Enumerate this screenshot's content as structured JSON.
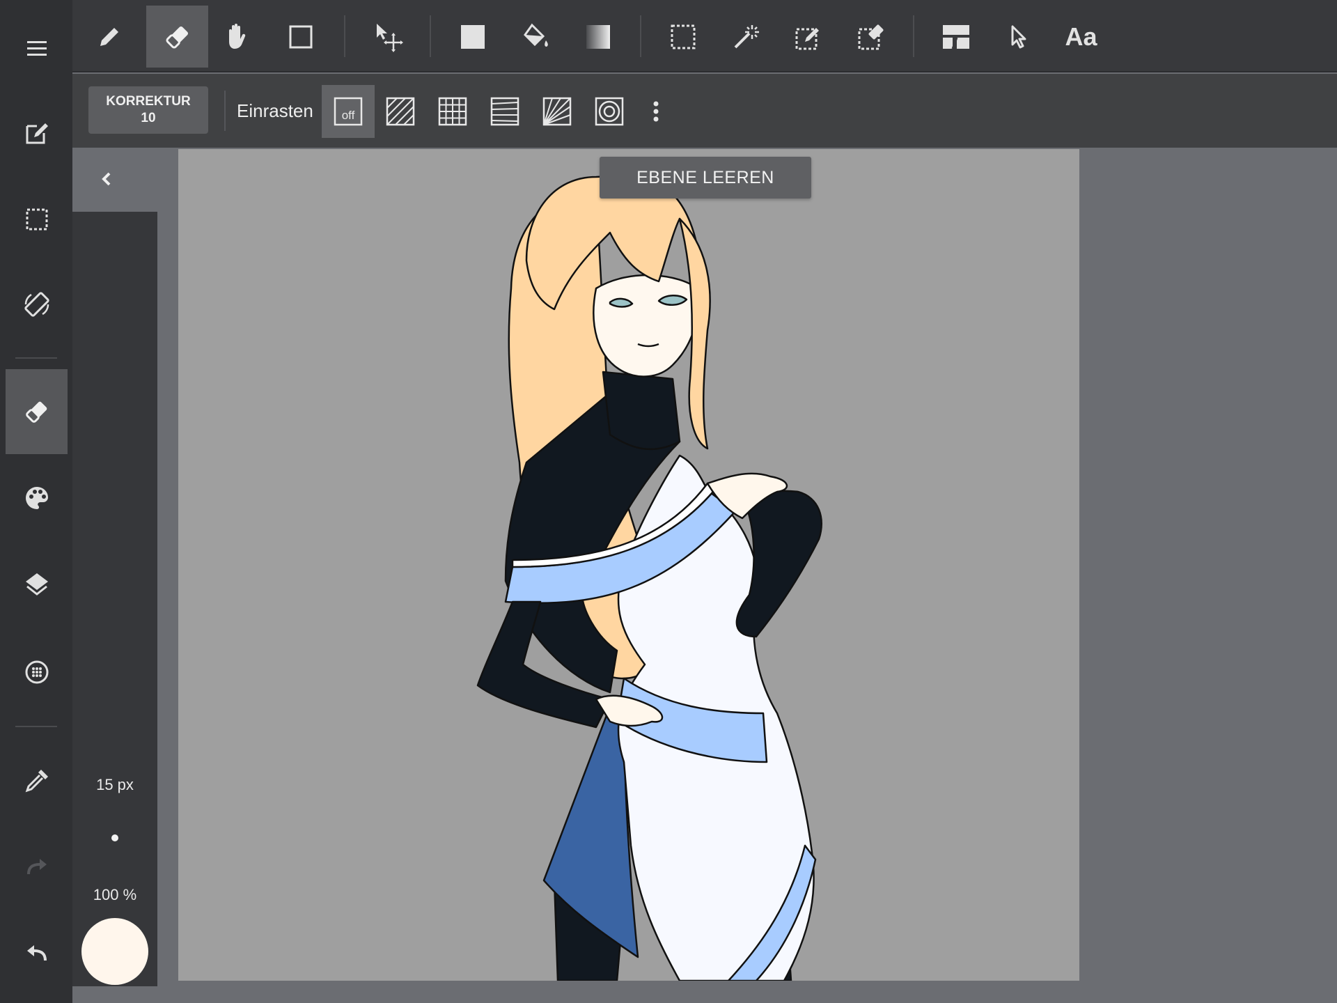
{
  "left_sidebar": {
    "items": [
      {
        "name": "menu-icon"
      },
      {
        "name": "edit-canvas-icon"
      },
      {
        "name": "selection-icon"
      },
      {
        "name": "rotate-screen-icon"
      },
      {
        "name": "eraser-icon",
        "active": true
      },
      {
        "name": "palette-icon"
      },
      {
        "name": "layers-icon"
      },
      {
        "name": "materials-icon"
      },
      {
        "name": "eyedropper-icon"
      },
      {
        "name": "redo-icon",
        "enabled": false
      },
      {
        "name": "undo-icon"
      }
    ]
  },
  "toolbar": {
    "tools": [
      "pen-icon",
      "eraser-icon",
      "hand-icon",
      "rectangle-icon",
      "move-icon",
      "fill-rect-icon",
      "bucket-icon",
      "gradient-icon",
      "select-rect-icon",
      "magic-wand-icon",
      "select-pen-icon",
      "select-eraser-icon",
      "frame-divider-icon",
      "cursor-icon"
    ],
    "active_tool": "eraser-icon",
    "text_tool_label": "Aa"
  },
  "sub_toolbar": {
    "correction_label": "KORREKTUR",
    "correction_value": "10",
    "snap_label": "Einrasten",
    "snap_off_label": "off",
    "snap_modes": [
      "snap-off",
      "snap-parallel",
      "snap-grid",
      "snap-perspective-lines",
      "snap-radial",
      "snap-circle"
    ],
    "more_icon": "more-vert-icon"
  },
  "brush": {
    "size": "15 px",
    "opacity": "100 %",
    "color": "#fff6ec"
  },
  "canvas": {
    "clear_layer_label": "EBENE LEEREN",
    "background": "#9f9f9f"
  }
}
